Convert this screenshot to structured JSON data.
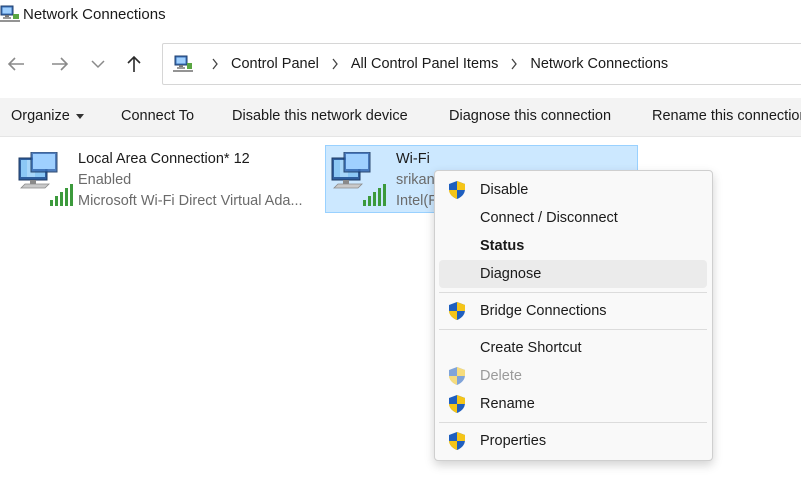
{
  "window": {
    "title": "Network Connections"
  },
  "nav": {
    "breadcrumbs": [
      "Control Panel",
      "All Control Panel Items",
      "Network Connections"
    ]
  },
  "commands": {
    "organize": "Organize",
    "connect_to": "Connect To",
    "disable_device": "Disable this network device",
    "diagnose": "Diagnose this connection",
    "rename": "Rename this connection"
  },
  "connections": [
    {
      "name": "Local Area Connection* 12",
      "status": "Enabled",
      "device": "Microsoft Wi-Fi Direct Virtual Ada..."
    },
    {
      "name": "Wi-Fi",
      "status": "srikan",
      "device": "Intel(R"
    }
  ],
  "context_menu": {
    "items": [
      {
        "label": "Disable",
        "shield": true
      },
      {
        "label": "Connect / Disconnect",
        "shield": false
      },
      {
        "label": "Status",
        "shield": false,
        "bold": true
      },
      {
        "label": "Diagnose",
        "shield": false,
        "highlighted": true
      },
      {
        "label": "Bridge Connections",
        "shield": true
      },
      {
        "label": "Create Shortcut",
        "shield": false
      },
      {
        "label": "Delete",
        "shield": true,
        "disabled": true
      },
      {
        "label": "Rename",
        "shield": true
      },
      {
        "label": "Properties",
        "shield": true
      }
    ]
  },
  "colors": {
    "selection_bg": "#cce8ff",
    "selection_border": "#99d1ff",
    "command_bar_bg": "#f3f3f3",
    "menu_hover": "#ebebeb",
    "disabled_text": "#9a9a9a"
  }
}
